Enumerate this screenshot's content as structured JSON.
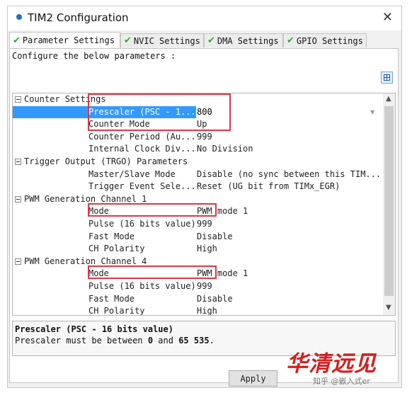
{
  "window": {
    "title": "TIM2 Configuration",
    "close_glyph": "✕"
  },
  "tabs": [
    {
      "label": "Parameter Settings",
      "icon": "check-icon",
      "active": true
    },
    {
      "label": "NVIC Settings",
      "icon": "check-icon",
      "active": false
    },
    {
      "label": "DMA Settings",
      "icon": "check-icon",
      "active": false
    },
    {
      "label": "GPIO Settings",
      "icon": "check-icon",
      "active": false
    }
  ],
  "check_glyph": "✔",
  "intro": "Configure the below parameters :",
  "groups": [
    {
      "name": "Counter Settings",
      "params": [
        {
          "name": "Prescaler (PSC - 1...",
          "value": "800",
          "selected": true
        },
        {
          "name": "Counter Mode",
          "value": "Up"
        },
        {
          "name": "Counter Period (Au...",
          "value": "999"
        },
        {
          "name": "Internal Clock Div...",
          "value": "No Division"
        }
      ]
    },
    {
      "name": "Trigger Output (TRGO) Parameters",
      "params": [
        {
          "name": "Master/Slave Mode",
          "value": "Disable (no sync between this TIM..."
        },
        {
          "name": "Trigger Event Sele...",
          "value": "Reset (UG bit from TIMx_EGR)"
        }
      ]
    },
    {
      "name": "PWM Generation Channel 1",
      "params": [
        {
          "name": "Mode",
          "value": "PWM mode 1"
        },
        {
          "name": "Pulse (16 bits value)",
          "value": "999"
        },
        {
          "name": "Fast Mode",
          "value": "Disable"
        },
        {
          "name": "CH Polarity",
          "value": "High"
        }
      ]
    },
    {
      "name": "PWM Generation Channel 4",
      "params": [
        {
          "name": "Mode",
          "value": "PWM mode 1"
        },
        {
          "name": "Pulse (16 bits value)",
          "value": "999"
        },
        {
          "name": "Fast Mode",
          "value": "Disable"
        },
        {
          "name": "CH Polarity",
          "value": "High"
        }
      ]
    }
  ],
  "scroll": {
    "up": "▲",
    "down": "▼"
  },
  "description": {
    "title": "Prescaler (PSC - 16 bits value)",
    "text_prefix": "Prescaler must be between ",
    "min": "0",
    "text_mid": " and ",
    "max": "65 535",
    "text_suffix": "."
  },
  "buttons": {
    "apply": "Apply"
  },
  "watermark": {
    "brand": "华清远见",
    "sub": "知乎 @嵌入式er"
  },
  "colors": {
    "highlight_box": "#d93a4a",
    "selection": "#3399ff",
    "check": "#3aa63a"
  }
}
